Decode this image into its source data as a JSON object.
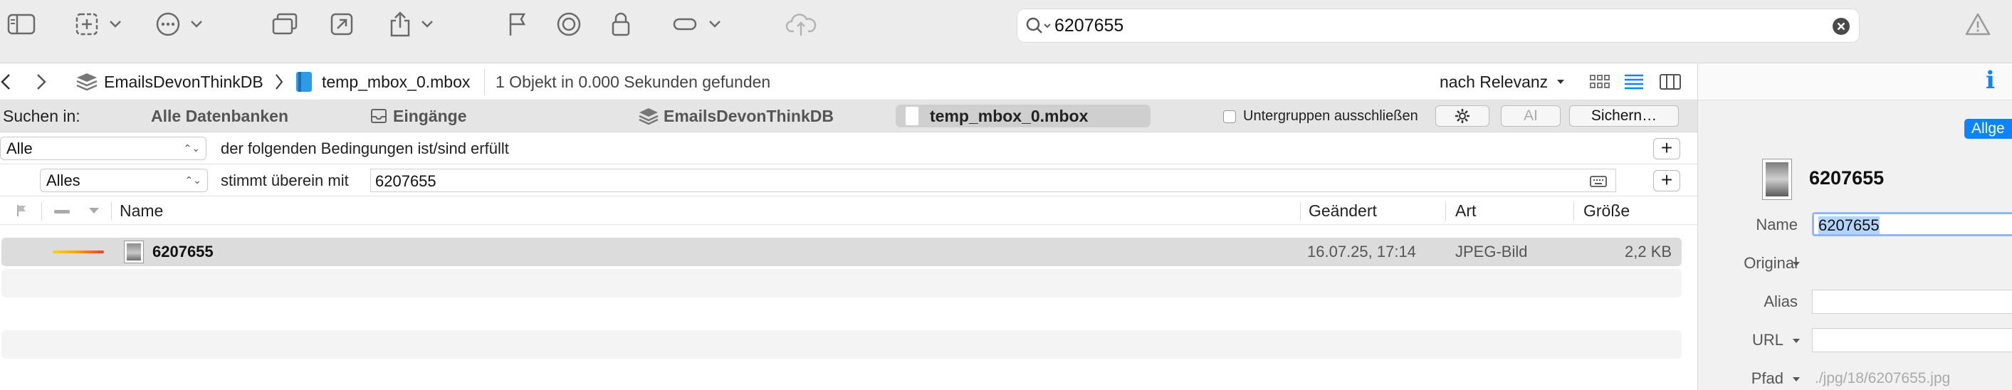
{
  "toolbar": {
    "icons": [
      "sidebar-icon",
      "new-item-icon",
      "chevron-down-icon",
      "more-icon",
      "chevron-down-icon",
      "windows-icon",
      "open-external-icon",
      "share-icon",
      "chevron-down-icon",
      "flag-icon",
      "mark-circle-icon",
      "lock-icon",
      "label-icon",
      "chevron-down-icon",
      "cloud-upload-icon",
      "warning-icon"
    ],
    "search_value": "6207655"
  },
  "pathbar": {
    "database": "EmailsDevonThinkDB",
    "group": "temp_mbox_0.mbox",
    "status": "1 Objekt in 0.000 Sekunden gefunden",
    "sort": "nach Relevanz"
  },
  "scope": {
    "label": "Suchen in:",
    "all_databases": "Alle Datenbanken",
    "inbox": "Eingänge",
    "database": "EmailsDevonThinkDB",
    "group": "temp_mbox_0.mbox",
    "exclude_subgroups": "Untergruppen ausschließen",
    "ai_button": "AI",
    "save_button": "Sichern…"
  },
  "conditions": {
    "match_mode": "Alle",
    "match_text": "der folgenden Bedingungen ist/sind erfüllt",
    "field": "Alles",
    "operator": "stimmt überein mit",
    "value": "6207655"
  },
  "table": {
    "columns": {
      "name": "Name",
      "modified": "Geändert",
      "kind": "Art",
      "size": "Größe"
    },
    "rows": [
      {
        "name": "6207655",
        "modified": "16.07.25, 17:14",
        "kind": "JPEG-Bild",
        "size": "2,2 KB"
      }
    ]
  },
  "inspector": {
    "info_icon": "i",
    "tag_button": "Allge",
    "title": "6207655",
    "labels": {
      "name": "Name",
      "original": "Original",
      "alias": "Alias",
      "url": "URL",
      "path": "Pfad"
    },
    "name_value": "6207655",
    "path_value": "./jpg/18/6207655.jpg"
  },
  "colors": {
    "accent": "#0a84ff",
    "selection_highlight": "#b3d4ff",
    "inspector_bg": "#f1f1f1"
  }
}
